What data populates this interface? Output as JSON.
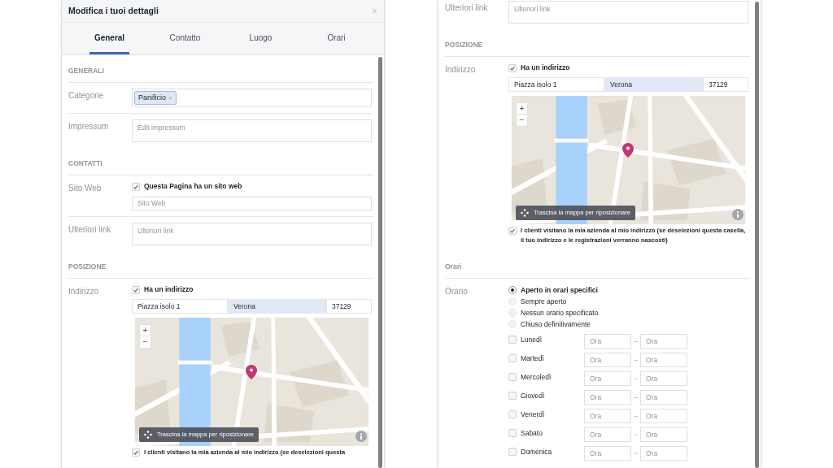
{
  "panels": [
    {
      "header": {
        "title": "Modifica i tuoi dettagli",
        "close": "×"
      },
      "tabs": [
        {
          "label": "General",
          "selected": true
        },
        {
          "label": "Contatto",
          "selected": false
        },
        {
          "label": "Luogo",
          "selected": false
        },
        {
          "label": "Orari",
          "selected": false
        }
      ],
      "sections": [
        {
          "heading": "GENERALI",
          "rows": [
            {
              "kind": "tags",
              "label": "Categorie",
              "tags": [
                {
                  "text": "Panificio",
                  "remove": "×"
                }
              ]
            },
            {
              "kind": "textarea",
              "label": "Impressum",
              "placeholder": "Edit impressum"
            }
          ]
        },
        {
          "heading": "CONTATTI",
          "rows": [
            {
              "kind": "checkfield",
              "label": "Sito Web",
              "checkbox": {
                "label": "Questa Pagina ha un sito web",
                "checked": true
              },
              "placeholder": "Sito Web"
            },
            {
              "kind": "textarea",
              "label": "Ulteriori link",
              "placeholder": "Ulteriori link"
            }
          ]
        },
        {
          "heading": "POSIZIONE",
          "rows": [
            {
              "kind": "address",
              "label": "Indirizzo",
              "checkbox": {
                "label": "Ha un indirizzo",
                "checked": true
              },
              "street": "Piazza isolo 1",
              "city": "Verona",
              "zip": "37129",
              "map": {
                "zoom_in": "+",
                "zoom_out": "−",
                "hint": "Trascina la mappa per riposizionare"
              },
              "visit_checkbox": {
                "label": "I clienti visitano la mia azienda al mio indirizzo (se deselezioni questa",
                "checked": true
              }
            }
          ]
        }
      ]
    },
    {
      "sections": [
        {
          "rows": [
            {
              "kind": "textarea",
              "label": "Ulteriori link",
              "placeholder": "Ulteriori link"
            }
          ]
        },
        {
          "heading": "POSIZIONE",
          "rows": [
            {
              "kind": "address",
              "label": "Indirizzo",
              "checkbox": {
                "label": "Ha un indirizzo",
                "checked": true
              },
              "street": "Piazza isolo 1",
              "city": "Verona",
              "zip": "37129",
              "map": {
                "zoom_in": "+",
                "zoom_out": "−",
                "hint": "Trascina la mappa per riposizionare"
              },
              "visit_checkbox": {
                "label": "I clienti visitano la mia azienda al mio indirizzo (se deselezioni questa casella, il tuo indirizzo e le registrazioni verranno nascosti)",
                "checked": true
              }
            }
          ]
        },
        {
          "heading": "Orari",
          "rows": [
            {
              "kind": "hours",
              "label": "Orario",
              "options": [
                {
                  "label": "Aperto in orari specifici",
                  "selected": true
                },
                {
                  "label": "Sempre aperto",
                  "selected": false
                },
                {
                  "label": "Nessun orario specificato",
                  "selected": false
                },
                {
                  "label": "Chiuso definitivamente",
                  "selected": false
                }
              ],
              "days": [
                {
                  "label": "Lunedì",
                  "checked": false,
                  "from": "Ora",
                  "separator": "–",
                  "to": "Ora"
                },
                {
                  "label": "Martedì",
                  "checked": false,
                  "from": "Ora",
                  "separator": "–",
                  "to": "Ora"
                },
                {
                  "label": "Mercoledì",
                  "checked": false,
                  "from": "Ora",
                  "separator": "–",
                  "to": "Ora"
                },
                {
                  "label": "Giovedì",
                  "checked": false,
                  "from": "Ora",
                  "separator": "–",
                  "to": "Ora"
                },
                {
                  "label": "Venerdì",
                  "checked": false,
                  "from": "Ora",
                  "separator": "–",
                  "to": "Ora"
                },
                {
                  "label": "Sabato",
                  "checked": false,
                  "from": "Ora",
                  "separator": "–",
                  "to": "Ora"
                },
                {
                  "label": "Domenica",
                  "checked": false,
                  "from": "Ora",
                  "separator": "–",
                  "to": "Ora"
                }
              ]
            }
          ]
        }
      ]
    }
  ]
}
